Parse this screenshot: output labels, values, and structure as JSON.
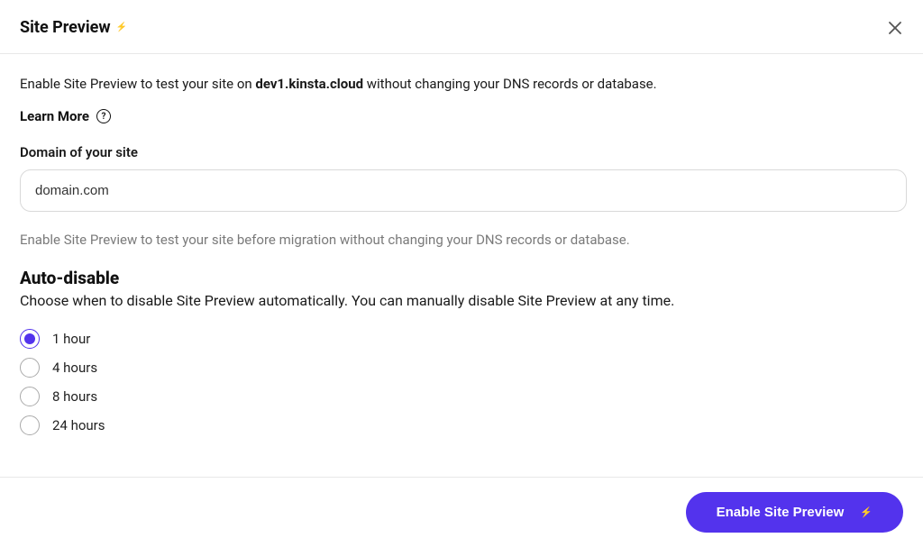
{
  "header": {
    "title": "Site Preview"
  },
  "intro": {
    "prefix": "Enable Site Preview to test your site on ",
    "bold": "dev1.kinsta.cloud",
    "suffix": " without changing your DNS records or database."
  },
  "learn_more": {
    "label": "Learn More"
  },
  "domain_field": {
    "label": "Domain of your site",
    "value": "domain.com"
  },
  "helper_text": "Enable Site Preview to test your site before migration without changing your DNS records or database.",
  "auto_disable": {
    "title": "Auto-disable",
    "description": "Choose when to disable Site Preview automatically. You can manually disable Site Preview at any time.",
    "options": [
      {
        "label": "1 hour",
        "selected": true
      },
      {
        "label": "4 hours",
        "selected": false
      },
      {
        "label": "8 hours",
        "selected": false
      },
      {
        "label": "24 hours",
        "selected": false
      }
    ]
  },
  "footer": {
    "primary_button": "Enable Site Preview"
  },
  "colors": {
    "accent": "#5333ed"
  }
}
